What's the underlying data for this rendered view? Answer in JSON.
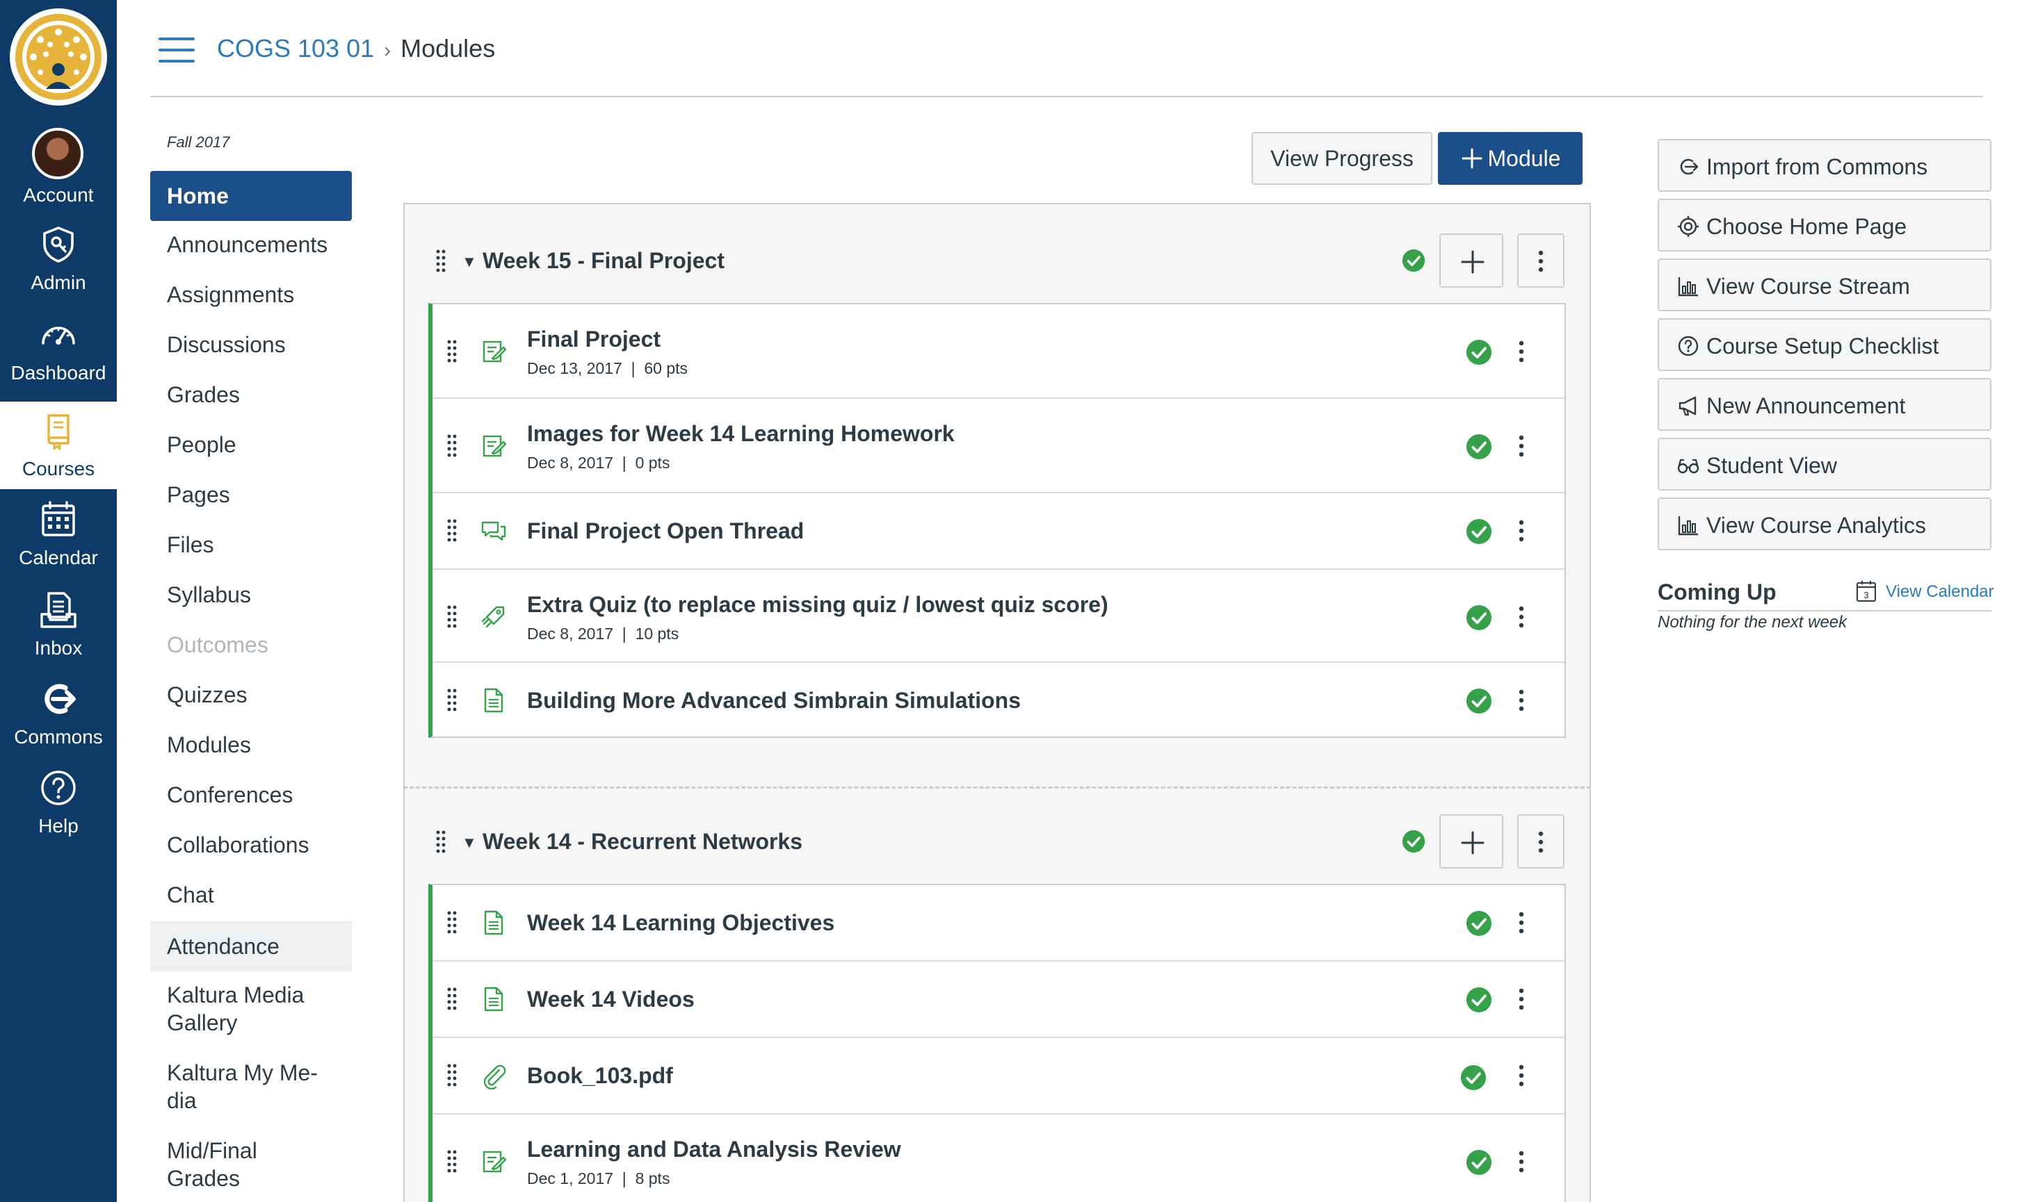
{
  "global_nav": {
    "items": [
      {
        "label": "Account",
        "icon": "avatar"
      },
      {
        "label": "Admin",
        "icon": "shield-icon"
      },
      {
        "label": "Dashboard",
        "icon": "speedometer-icon"
      },
      {
        "label": "Courses",
        "icon": "book-icon"
      },
      {
        "label": "Calendar",
        "icon": "calendar-icon"
      },
      {
        "label": "Inbox",
        "icon": "inbox-icon"
      },
      {
        "label": "Commons",
        "icon": "commons-icon"
      },
      {
        "label": "Help",
        "icon": "help-icon"
      }
    ],
    "active": "Courses",
    "colors": {
      "bg": "#0e3a67",
      "logo_gold": "#e7b43b",
      "active_fg": "#0e3a67"
    }
  },
  "breadcrumb": {
    "course": "COGS 103 01",
    "page": "Modules"
  },
  "course_nav": {
    "term": "Fall 2017",
    "items": [
      "Home",
      "Announcements",
      "Assignments",
      "Discussions",
      "Grades",
      "People",
      "Pages",
      "Files",
      "Syllabus",
      "Outcomes",
      "Quizzes",
      "Modules",
      "Conferences",
      "Collaborations",
      "Chat",
      "Attendance",
      "Kaltura Media Gallery",
      "Kaltura My Me-dia",
      "Mid/Final Grades"
    ],
    "kaltura_media_gallery": [
      "Kaltura Media",
      "Gallery"
    ],
    "kaltura_my_media": [
      "Kaltura My Me-",
      "dia"
    ],
    "mid_final_grades": [
      "Mid/Final",
      "Grades"
    ]
  },
  "toolbar": {
    "view_progress": "View Progress",
    "add_module": "Module"
  },
  "modules": [
    {
      "title": "Week 15 - Final Project",
      "items": [
        {
          "icon": "assignment-icon",
          "name": "Final Project",
          "date": "Dec 13, 2017",
          "points": "60 pts"
        },
        {
          "icon": "assignment-icon",
          "name": "Images for Week 14 Learning Homework",
          "date": "Dec 8, 2017",
          "points": "0 pts"
        },
        {
          "icon": "discussion-icon",
          "name": "Final Project Open Thread"
        },
        {
          "icon": "quiz-icon",
          "name": "Extra Quiz (to replace missing quiz / lowest quiz score)",
          "date": "Dec 8, 2017",
          "points": "10 pts"
        },
        {
          "icon": "page-icon",
          "name": "Building More Advanced Simbrain Simulations"
        }
      ]
    },
    {
      "title": "Week 14 - Recurrent Networks",
      "items": [
        {
          "icon": "page-icon",
          "name": "Week 14 Learning Objectives"
        },
        {
          "icon": "page-icon",
          "name": "Week 14 Videos"
        },
        {
          "icon": "attachment-icon",
          "name": "Book_103.pdf"
        },
        {
          "icon": "assignment-icon",
          "name": "Learning and Data Analysis Review",
          "date": "Dec 1, 2017",
          "points": "8 pts"
        }
      ]
    }
  ],
  "sidebar": {
    "buttons": [
      {
        "label": "Import from Commons",
        "icon": "commons-icon"
      },
      {
        "label": "Choose Home Page",
        "icon": "target-icon"
      },
      {
        "label": "View Course Stream",
        "icon": "bar-chart-icon"
      },
      {
        "label": "Course Setup Checklist",
        "icon": "question-circle-icon"
      },
      {
        "label": "New Announcement",
        "icon": "megaphone-icon"
      },
      {
        "label": "Student View",
        "icon": "glasses-icon"
      },
      {
        "label": "View Course Analytics",
        "icon": "bar-chart-icon"
      }
    ],
    "coming_up": {
      "heading": "Coming Up",
      "calendar_link": "View Calendar",
      "calendar_day": "3",
      "empty": "Nothing for the next week"
    }
  },
  "colors": {
    "link": "#2b7abc",
    "published": "#35a24a",
    "primary": "#1b4f8a",
    "text": "#2d3b45",
    "border": "#c7cdd1"
  }
}
